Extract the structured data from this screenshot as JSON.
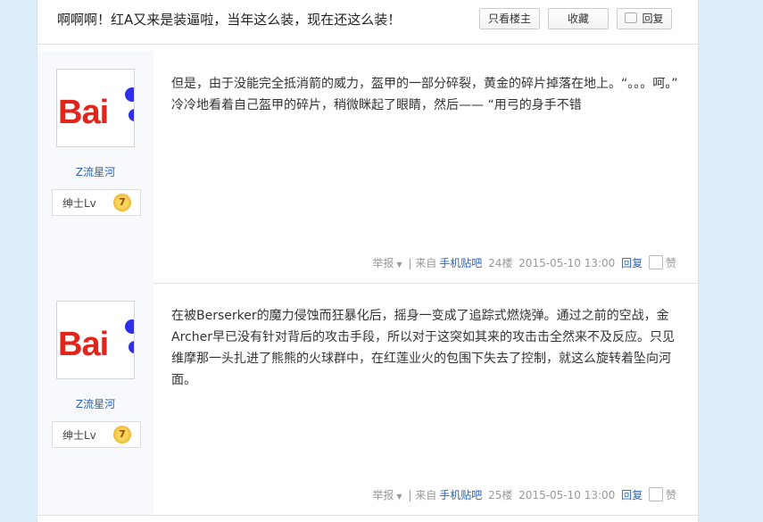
{
  "header": {
    "title": "啊啊啊！红A又来是装逼啦，当年这么装，现在还这么装！",
    "only_author_label": "只看楼主",
    "collect_label": "收藏",
    "reply_label": "回复"
  },
  "posts": [
    {
      "avatar_text": "Bai",
      "username": "Z流星河",
      "level_label": "绅士Lv",
      "level": "7",
      "content": "但是，由于没能完全抵消箭的威力，盔甲的一部分碎裂，黄金的碎片掉落在地上。“。。。呵。” 冷冷地看着自己盔甲的碎片，稍微眯起了眼睛，然后—— “用弓的身手不错",
      "report": "举报",
      "source_prefix": "| 来自",
      "source_link": "手机贴吧",
      "floor": "24楼",
      "time": "2015-05-10 13:00",
      "reply": "回复",
      "like": "赞"
    },
    {
      "avatar_text": "Bai",
      "username": "Z流星河",
      "level_label": "绅士Lv",
      "level": "7",
      "content": "在被Berserker的魔力侵蚀而狂暴化后，摇身一变成了追踪式燃烧弹。通过之前的空战，金Archer早已没有针对背后的攻击手段，所以对于这突如其来的攻击击全然来不及反应。只见维摩那一头扎进了熊熊的火球群中，在红莲业火的包围下失去了控制，就这么旋转着坠向河面。",
      "report": "举报",
      "source_prefix": "| 来自",
      "source_link": "手机贴吧",
      "floor": "25楼",
      "time": "2015-05-10 13:00",
      "reply": "回复",
      "like": "赞"
    }
  ]
}
